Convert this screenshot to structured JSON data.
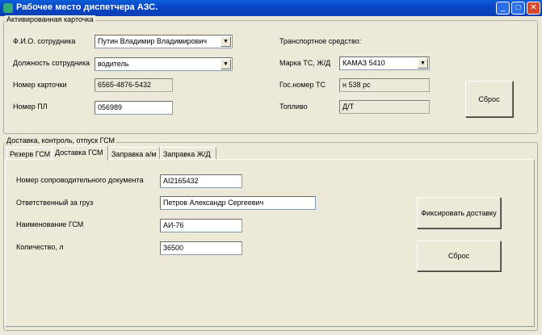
{
  "window": {
    "title": "Рабочее место диспетчера АЗС.",
    "min": "_",
    "max": "□",
    "close": "✕"
  },
  "card": {
    "group_label": "Активированная карточка",
    "fio_label": "Ф.И.О. сотрудника",
    "fio_value": "Путин Владимир Владимирович",
    "position_label": "Должность сотрудника",
    "position_value": "водитель",
    "card_no_label": "Номер карточки",
    "card_no_value": "6565-4876-5432",
    "pl_label": "Номер ПЛ",
    "pl_value": "056989",
    "vehicle_heading": "Транспортное средство:",
    "brand_label": "Марка ТС, Ж/Д",
    "brand_value": "КАМАЗ 5410",
    "plate_label": "Гос.номер ТС",
    "plate_value": "н 538 рс",
    "fuel_label": "Топливо",
    "fuel_value": "Д/Т",
    "reset_label": "Сброс",
    "arrow": "▼"
  },
  "delivery": {
    "group_label": "Доставка, контроль, отпуск ГСМ",
    "tabs": [
      "Резерв ГСМ",
      "Доставка ГСМ",
      "Заправка а/м",
      "Заправка Ж/Д"
    ],
    "doc_label": "Номер сопроводительного документа",
    "doc_value": "AI2165432",
    "resp_label": "Ответственный за груз",
    "resp_value": "Петров Александр Сергеевич",
    "gsm_label": "Наименование ГСМ",
    "gsm_value": "АИ-76",
    "qty_label": "Количество, л",
    "qty_value": "36500",
    "fix_label": "Фиксировать доставку",
    "reset_label": "Сброс"
  }
}
